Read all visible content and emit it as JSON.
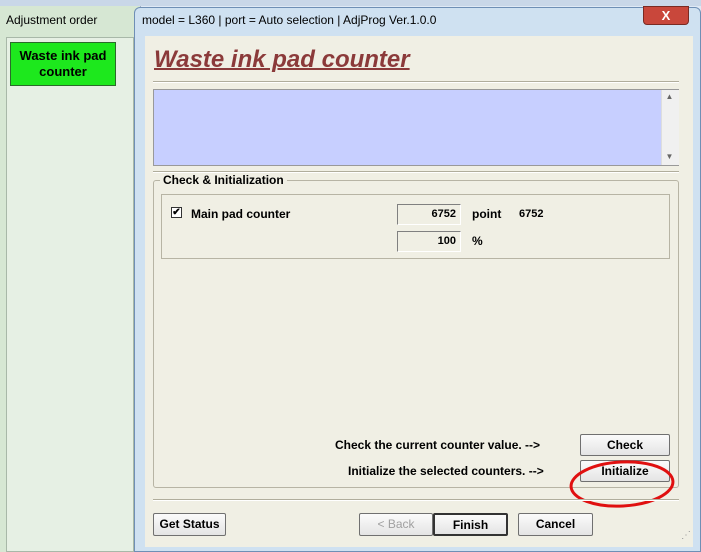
{
  "background_window": {
    "title": "Adjustment order",
    "items": [
      {
        "label": "Waste ink pad counter"
      }
    ]
  },
  "dialog": {
    "title": "model = L360 | port = Auto selection | AdjProg Ver.1.0.0",
    "close_label": "X",
    "page_title": "Waste ink pad counter",
    "group_label": "Check & Initialization",
    "counter": {
      "checked": true,
      "check_mark": "✔",
      "label": "Main pad counter",
      "point_value": "6752",
      "point_unit": "point",
      "point_extra": "6752",
      "percent_value": "100",
      "percent_unit": "%"
    },
    "check_prompt": "Check the current counter value. -->",
    "check_button": "Check",
    "init_prompt": "Initialize the selected counters. -->",
    "init_button": "Initialize",
    "buttons": {
      "get_status": "Get Status",
      "back": "< Back",
      "finish": "Finish",
      "cancel": "Cancel"
    }
  },
  "colors": {
    "title_accent": "#8b3a3a",
    "waste_button": "#1de81d",
    "info_box": "#c7cfff",
    "annotation": "#e01010"
  }
}
